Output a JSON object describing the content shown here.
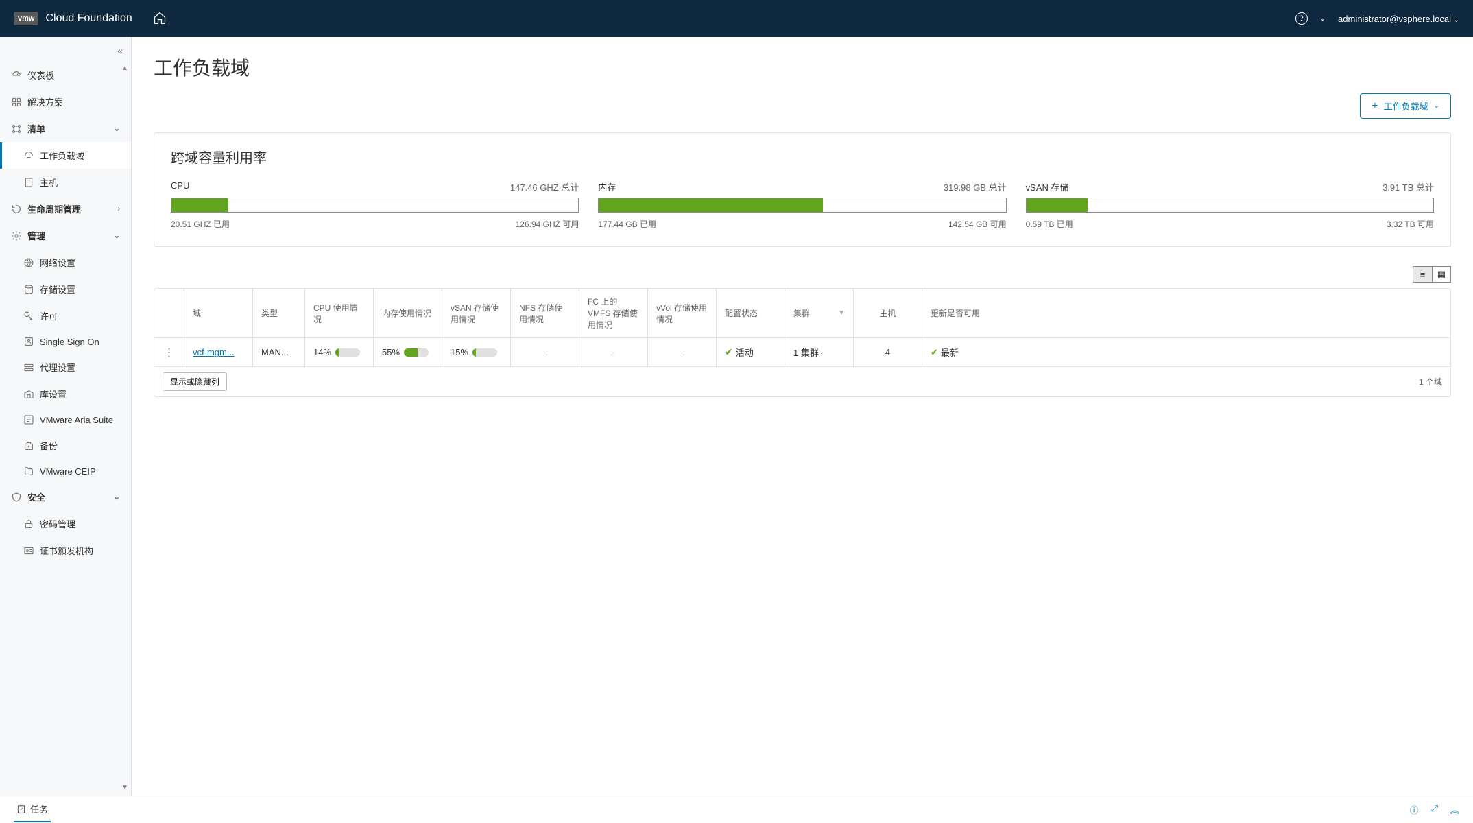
{
  "header": {
    "logo": "vmw",
    "product": "Cloud Foundation",
    "user": "administrator@vsphere.local"
  },
  "sidebar": {
    "dashboard": "仪表板",
    "solutions": "解决方案",
    "inventory": "清单",
    "workload_domains": "工作负载域",
    "hosts": "主机",
    "lifecycle": "生命周期管理",
    "admin": "管理",
    "network_settings": "网络设置",
    "storage_settings": "存储设置",
    "licensing": "许可",
    "sso": "Single Sign On",
    "proxy": "代理设置",
    "depot": "库设置",
    "aria": "VMware Aria Suite",
    "backup": "备份",
    "ceip": "VMware CEIP",
    "security": "安全",
    "password": "密码管理",
    "cert": "证书颁发机构"
  },
  "page": {
    "title": "工作负载域",
    "add_button": "工作负载域"
  },
  "capacity": {
    "title": "跨域容量利用率",
    "cpu": {
      "label": "CPU",
      "total": "147.46 GHZ 总计",
      "used": "20.51 GHZ 已用",
      "free": "126.94 GHZ 可用",
      "pct": 14
    },
    "mem": {
      "label": "内存",
      "total": "319.98 GB 总计",
      "used": "177.44 GB 已用",
      "free": "142.54 GB 可用",
      "pct": 55
    },
    "vsan": {
      "label": "vSAN 存储",
      "total": "3.91 TB 总计",
      "used": "0.59 TB 已用",
      "free": "3.32 TB 可用",
      "pct": 15
    }
  },
  "table": {
    "headers": {
      "domain": "域",
      "type": "类型",
      "cpu": "CPU 使用情况",
      "mem": "内存使用情况",
      "vsan": "vSAN 存储使用情况",
      "nfs": "NFS 存储使用情况",
      "vmfs": "FC 上的 VMFS 存储使用情况",
      "vvol": "vVol 存储使用情况",
      "status": "配置状态",
      "cluster": "集群",
      "host": "主机",
      "update": "更新是否可用"
    },
    "row": {
      "domain": "vcf-mgm...",
      "type": "MAN...",
      "cpu": "14%",
      "mem": "55%",
      "vsan": "15%",
      "nfs": "-",
      "vmfs": "-",
      "vvol": "-",
      "status": "活动",
      "cluster": "1 集群",
      "host": "4",
      "update": "最新"
    },
    "toggle_cols": "显示或隐藏列",
    "count": "1 个域"
  },
  "bottom": {
    "tasks": "任务"
  }
}
